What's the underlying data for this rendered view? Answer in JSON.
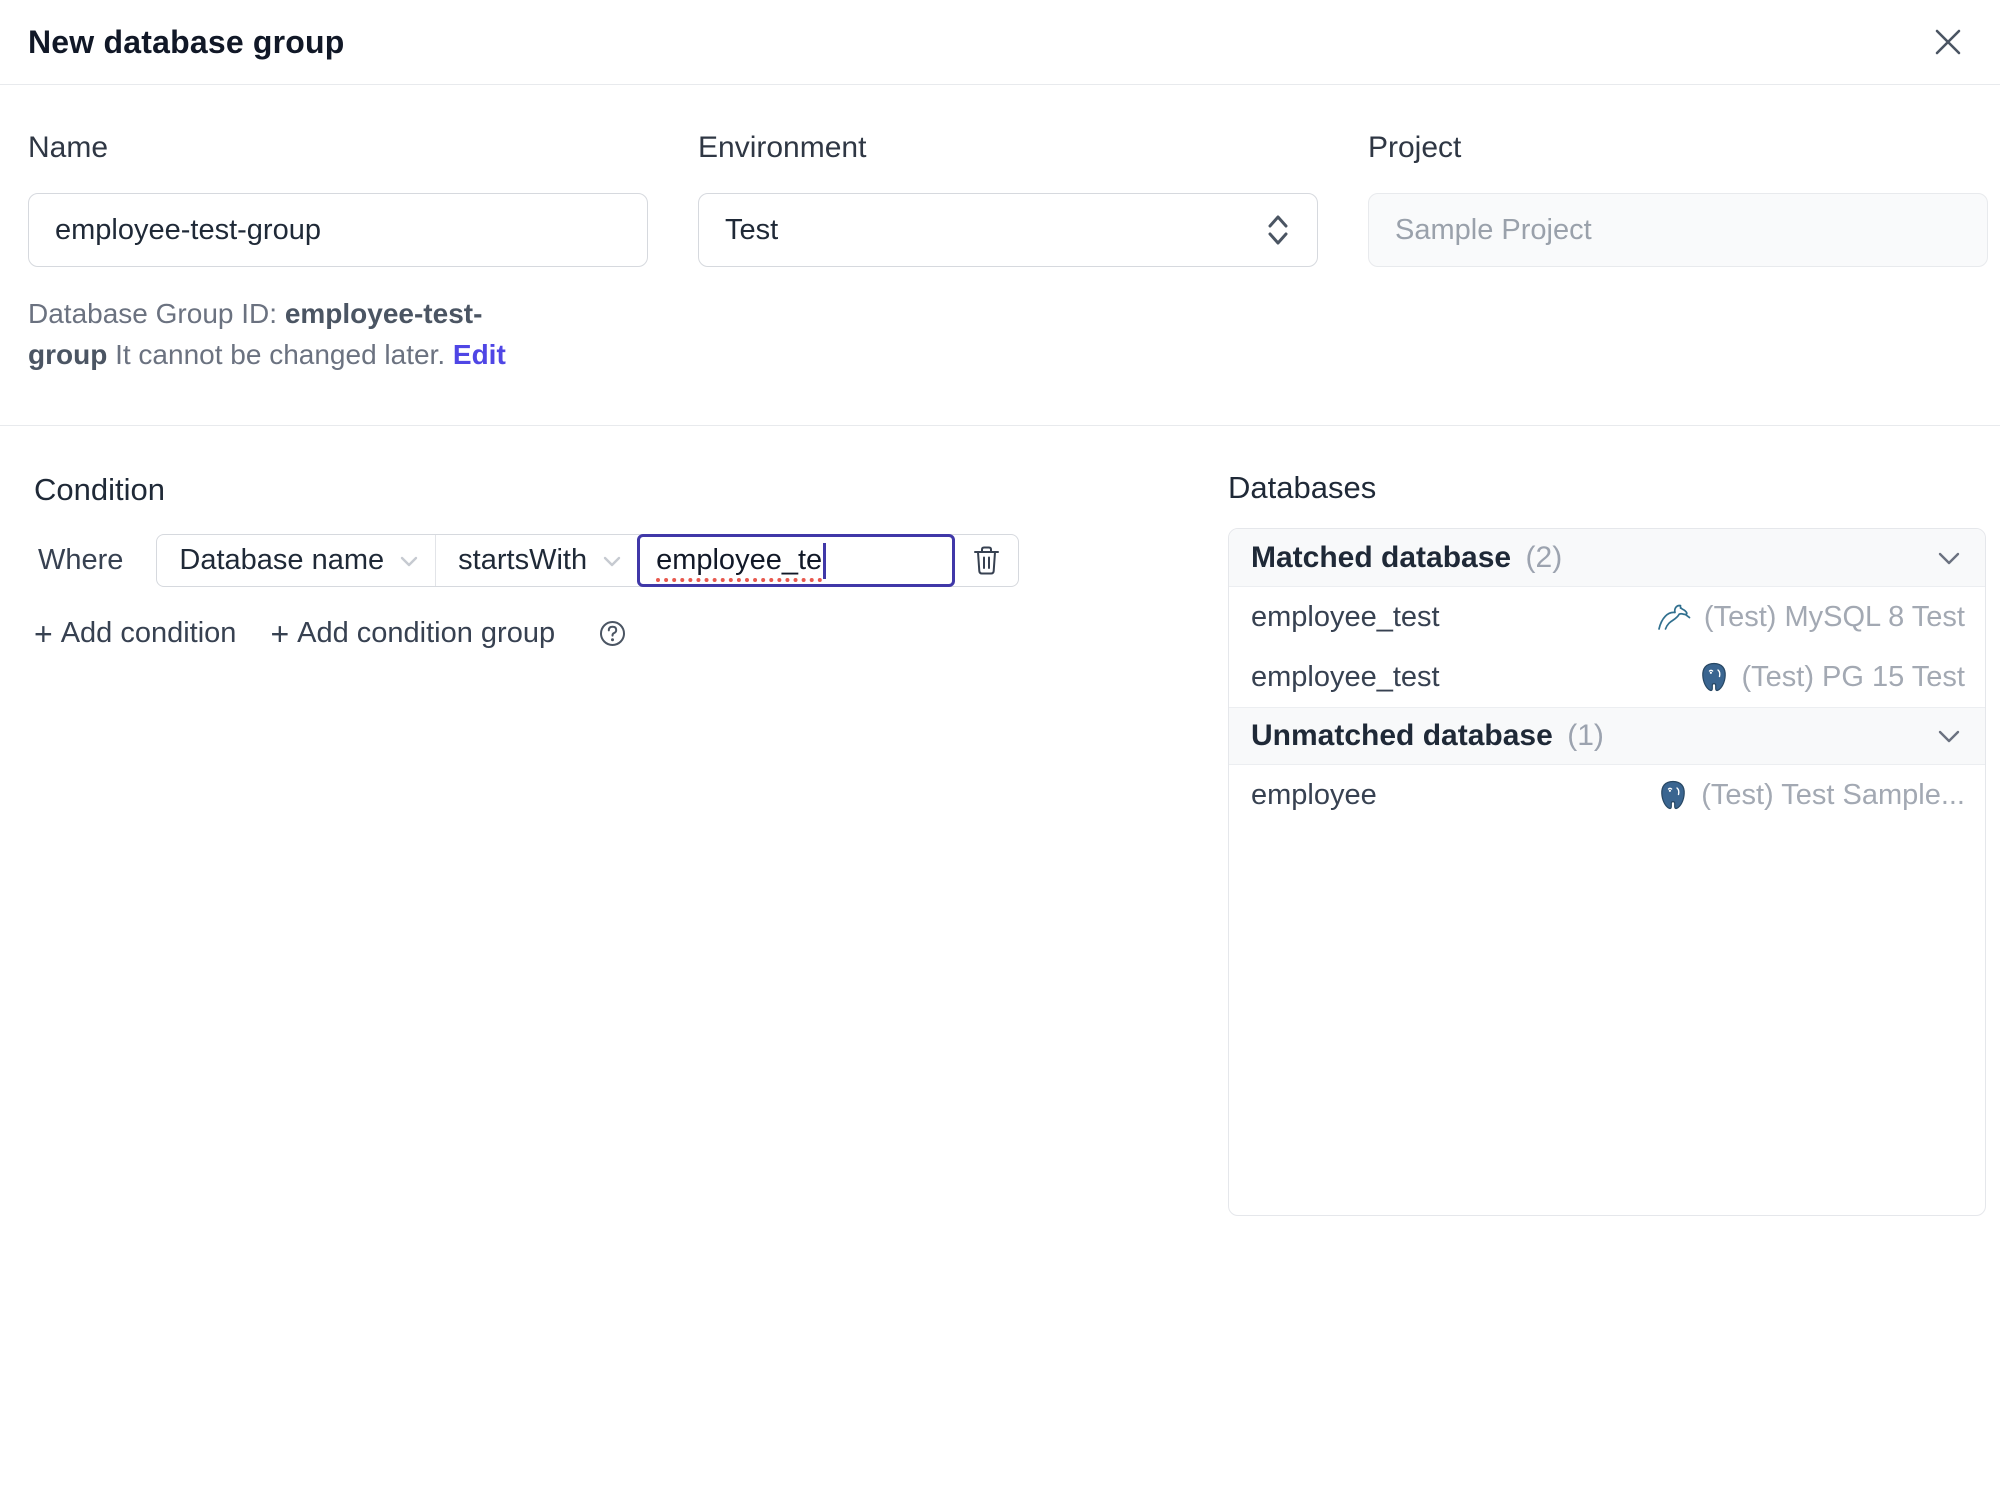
{
  "header": {
    "title": "New database group"
  },
  "form": {
    "name": {
      "label": "Name",
      "value": "employee-test-group"
    },
    "environment": {
      "label": "Environment",
      "value": "Test"
    },
    "project": {
      "label": "Project",
      "value": "Sample Project"
    },
    "group_id_note": {
      "prefix": "Database Group ID: ",
      "id": "employee-test-group",
      "suffix": " It cannot be changed later. ",
      "edit_label": "Edit"
    }
  },
  "condition": {
    "heading": "Condition",
    "where_label": "Where",
    "field_selector": "Database name",
    "operator_selector": "startsWith",
    "value": "employee_te",
    "add_condition_label": "Add condition",
    "add_condition_group_label": "Add condition group",
    "plus": "+"
  },
  "databases": {
    "heading": "Databases",
    "sections": [
      {
        "title": "Matched database",
        "count": "(2)",
        "rows": [
          {
            "name": "employee_test",
            "engine": "mysql",
            "instance": "(Test) MySQL 8 Test"
          },
          {
            "name": "employee_test",
            "engine": "postgres",
            "instance": "(Test) PG 15 Test"
          }
        ]
      },
      {
        "title": "Unmatched database",
        "count": "(1)",
        "rows": [
          {
            "name": "employee",
            "engine": "postgres",
            "instance": "(Test) Test Sample..."
          }
        ]
      }
    ]
  },
  "colors": {
    "accent": "#4f46e5",
    "focus_border": "#4038a8",
    "spellcheck_underline": "#e8594f",
    "panel_header_bg": "#f8f9fa",
    "muted_text": "#9ca3af"
  }
}
